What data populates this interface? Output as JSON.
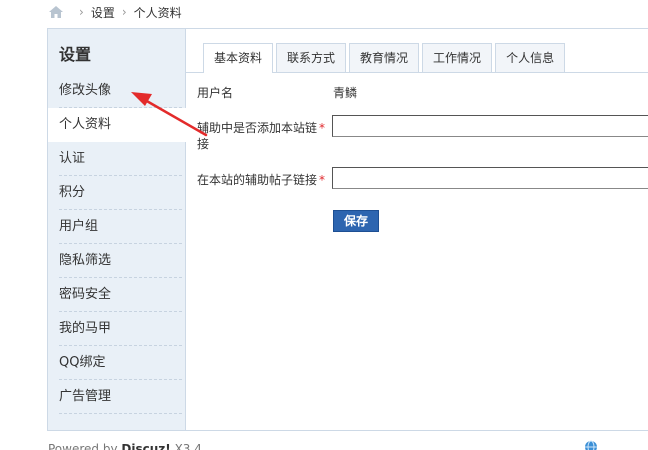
{
  "breadcrumb": {
    "items": [
      "设置",
      "个人资料"
    ]
  },
  "sidebar": {
    "title": "设置",
    "items": [
      {
        "label": "修改头像"
      },
      {
        "label": "个人资料"
      },
      {
        "label": "认证"
      },
      {
        "label": "积分"
      },
      {
        "label": "用户组"
      },
      {
        "label": "隐私筛选"
      },
      {
        "label": "密码安全"
      },
      {
        "label": "我的马甲"
      },
      {
        "label": "QQ绑定"
      },
      {
        "label": "广告管理"
      }
    ]
  },
  "tabs": [
    {
      "label": "基本资料"
    },
    {
      "label": "联系方式"
    },
    {
      "label": "教育情况"
    },
    {
      "label": "工作情况"
    },
    {
      "label": "个人信息"
    }
  ],
  "form": {
    "username_label": "用户名",
    "username_value": "青鳞",
    "field1_label_line1": "辅助中是否添加本站链",
    "field1_label_line2": "接",
    "field1_value": "",
    "field2_label": "在本站的辅助帖子链接",
    "field2_value": "",
    "required_mark": "*",
    "save_label": "保存"
  },
  "footer": {
    "powered_by": "Powered by",
    "brand": "Discuz!",
    "version": "X3.4"
  },
  "colors": {
    "sidebar_bg": "#e9f0f7",
    "border": "#cdd9e6",
    "button": "#2d65b0",
    "required": "#e0282c",
    "arrow": "#e32b2b"
  }
}
